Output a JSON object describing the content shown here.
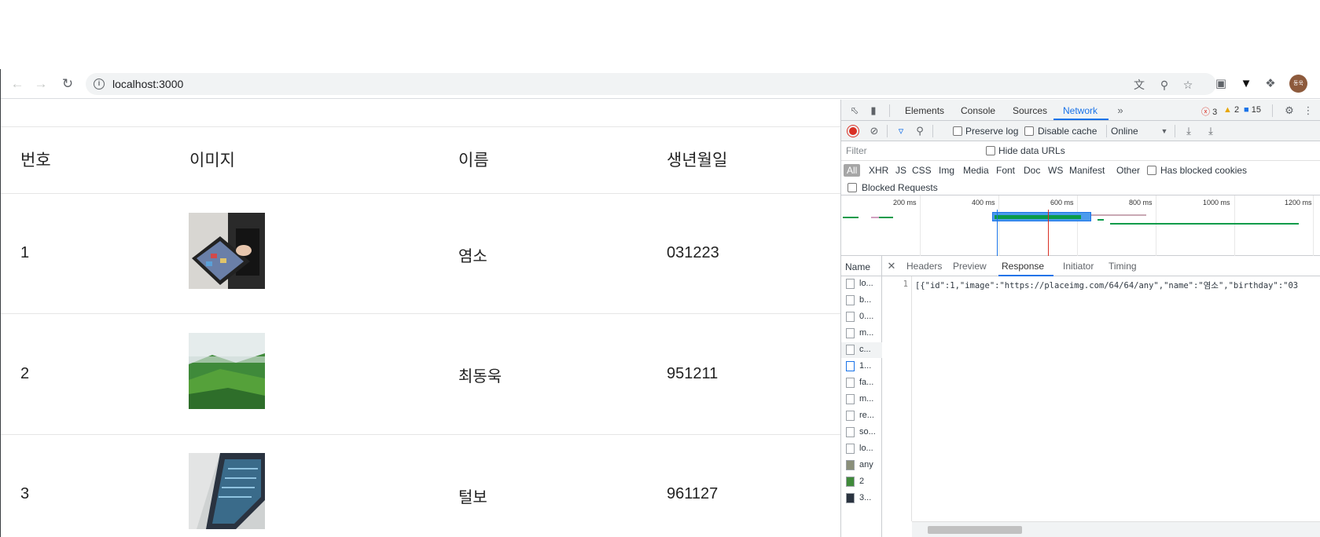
{
  "browser": {
    "back_icon": "arrow-left-icon",
    "forward_icon": "arrow-right-icon",
    "reload_icon": "reload-icon",
    "url": "localhost:3000",
    "avatar_text": "동욱"
  },
  "table": {
    "headers": [
      "번호",
      "이미지",
      "이름",
      "생년월일"
    ],
    "rows": [
      {
        "no": "1",
        "name": "염소",
        "birthday": "031223"
      },
      {
        "no": "2",
        "name": "최동욱",
        "birthday": "951211"
      },
      {
        "no": "3",
        "name": "털보",
        "birthday": "961127"
      }
    ]
  },
  "devtools": {
    "tabs": [
      "Elements",
      "Console",
      "Sources",
      "Network"
    ],
    "active_tab": "Network",
    "errors": "3",
    "warnings": "2",
    "messages": "15",
    "toolbar": {
      "preserve_log": "Preserve log",
      "disable_cache": "Disable cache",
      "throttle": "Online"
    },
    "filter": {
      "placeholder": "Filter",
      "hide_data_urls": "Hide data URLs",
      "types": [
        "All",
        "XHR",
        "JS",
        "CSS",
        "Img",
        "Media",
        "Font",
        "Doc",
        "WS",
        "Manifest",
        "Other"
      ],
      "has_blocked_cookies": "Has blocked cookies",
      "blocked_requests": "Blocked Requests"
    },
    "timeline_ticks": [
      "200 ms",
      "400 ms",
      "600 ms",
      "800 ms",
      "1000 ms",
      "1200 ms"
    ],
    "name_header": "Name",
    "requests": [
      "lo...",
      "b...",
      "0....",
      "m...",
      "c...",
      "1...",
      "fa...",
      "m...",
      "re...",
      "so...",
      "lo...",
      "any",
      "2",
      "3..."
    ],
    "detail_tabs": [
      "Headers",
      "Preview",
      "Response",
      "Initiator",
      "Timing"
    ],
    "active_detail_tab": "Response",
    "response_line_no": "1",
    "response_text": "[{\"id\":1,\"image\":\"https://placeimg.com/64/64/any\",\"name\":\"염소\",\"birthday\":\"03"
  }
}
